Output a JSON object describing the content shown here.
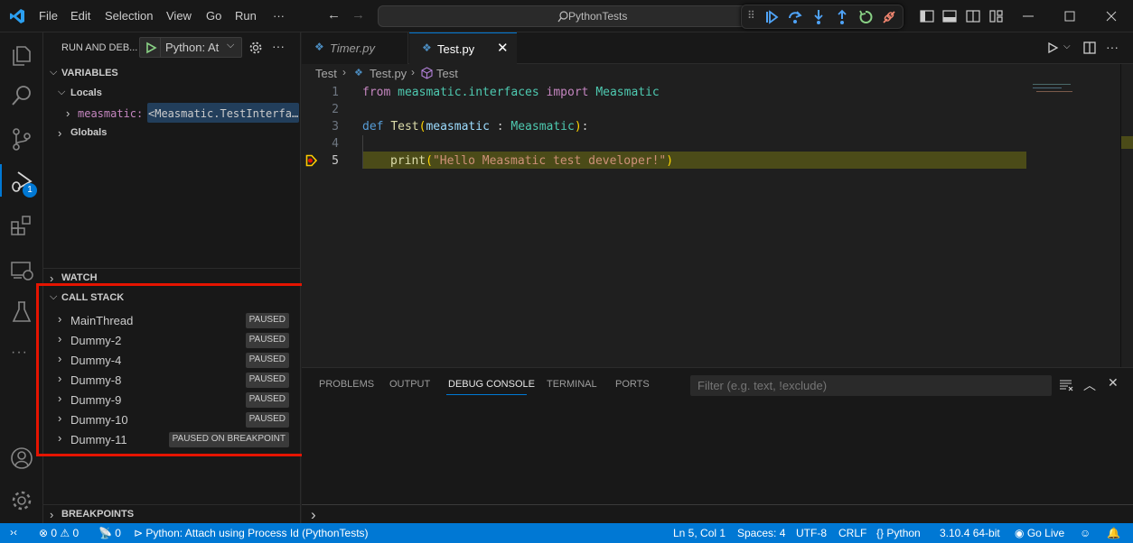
{
  "titlebar": {
    "menu": [
      "File",
      "Edit",
      "Selection",
      "View",
      "Go",
      "Run",
      "···"
    ],
    "search_text": "PythonTests",
    "debug_toolbar": [
      "drag-handle",
      "continue",
      "step-over",
      "step-into",
      "step-out",
      "restart",
      "disconnect"
    ]
  },
  "sidebar": {
    "header_title": "RUN AND DEB...",
    "launch_config": "Python: At",
    "variables_title": "VARIABLES",
    "locals_label": "Locals",
    "variable_name": "measmatic:",
    "variable_value": "<Measmatic.TestInterfa…",
    "globals_label": "Globals",
    "watch_title": "WATCH",
    "callstack_title": "CALL STACK",
    "threads": [
      {
        "name": "MainThread",
        "status": "PAUSED"
      },
      {
        "name": "Dummy-2",
        "status": "PAUSED"
      },
      {
        "name": "Dummy-4",
        "status": "PAUSED"
      },
      {
        "name": "Dummy-8",
        "status": "PAUSED"
      },
      {
        "name": "Dummy-9",
        "status": "PAUSED"
      },
      {
        "name": "Dummy-10",
        "status": "PAUSED"
      },
      {
        "name": "Dummy-11",
        "status": "PAUSED ON BREAKPOINT"
      }
    ],
    "breakpoints_title": "BREAKPOINTS"
  },
  "activitybar": {
    "debug_badge": "1"
  },
  "editor": {
    "tabs": [
      {
        "label": "Timer.py",
        "active": false
      },
      {
        "label": "Test.py",
        "active": true
      }
    ],
    "breadcrumb": [
      "Test",
      "Test.py",
      "Test"
    ],
    "lines": [
      {
        "num": "1"
      },
      {
        "num": "2"
      },
      {
        "num": "3"
      },
      {
        "num": "4"
      },
      {
        "num": "5"
      }
    ],
    "line1": {
      "kw_from": "from",
      "module": "measmatic.interfaces",
      "kw_import": "import",
      "cls": "Measmatic"
    },
    "line3": {
      "kw_def": "def",
      "fn": "Test",
      "open": "(",
      "param": "measmatic",
      "colon": " : ",
      "type": "Measmatic",
      "close": ")",
      "end": ":"
    },
    "line5": {
      "fn": "print",
      "open": "(",
      "str": "\"Hello Measmatic test developer!\"",
      "close": ")"
    }
  },
  "panel": {
    "tabs": [
      "PROBLEMS",
      "OUTPUT",
      "DEBUG CONSOLE",
      "TERMINAL",
      "PORTS"
    ],
    "active_tab": "DEBUG CONSOLE",
    "filter_placeholder": "Filter (e.g. text, !exclude)",
    "prompt": "›"
  },
  "statusbar": {
    "errors": "0",
    "warnings": "0",
    "ports": "0",
    "debug_config": "Python: Attach using Process Id (PythonTests)",
    "position": "Ln 5, Col 1",
    "spaces": "Spaces: 4",
    "encoding": "UTF-8",
    "eol": "CRLF",
    "language": "Python",
    "interpreter": "3.10.4 64-bit",
    "golive": "Go Live"
  },
  "colors": {
    "accent": "#0078d4",
    "highlight_line": "#4b4b18",
    "callstack_outline": "#e51400"
  }
}
